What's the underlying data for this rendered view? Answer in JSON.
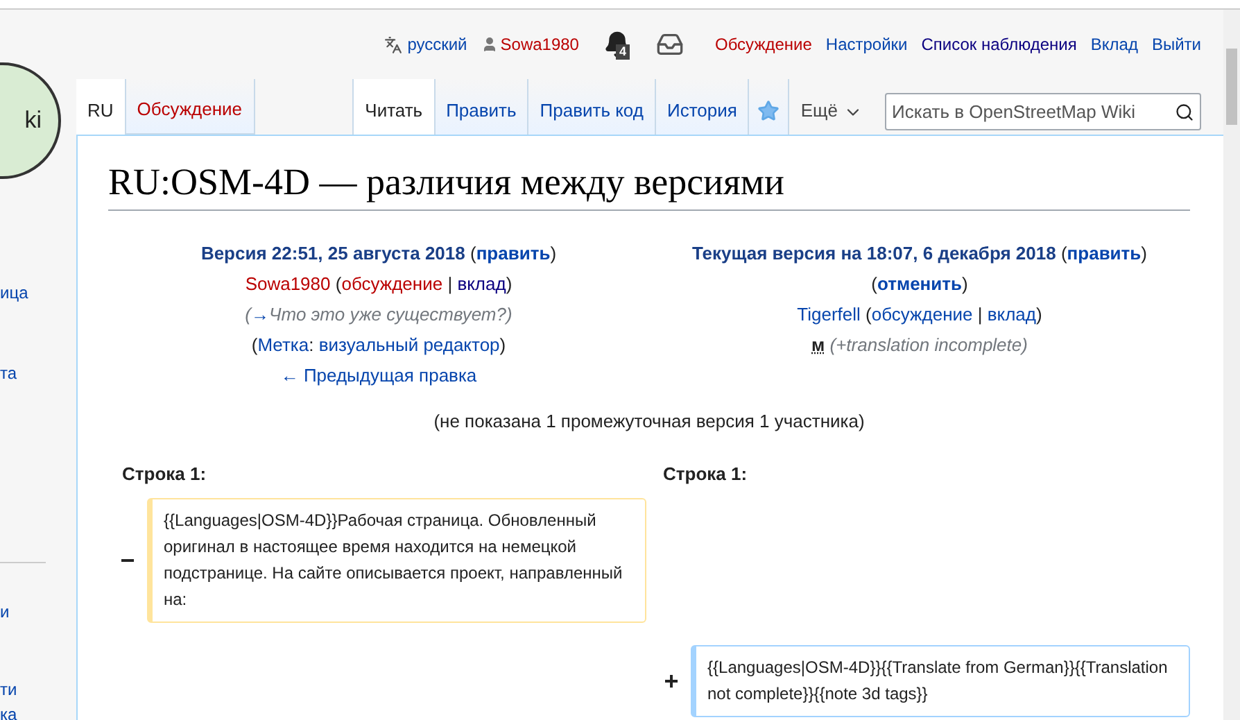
{
  "logo": {
    "text": "ki"
  },
  "sidebar": {
    "items": [
      "ица",
      "та",
      "и",
      "ти",
      "ка"
    ]
  },
  "personal_bar": {
    "language": "русский",
    "user": "Sowa1980",
    "notifications": "4",
    "links": [
      {
        "label": "Обсуждение",
        "color": "#ba0000"
      },
      {
        "label": "Настройки",
        "color": "#0645ad"
      },
      {
        "label": "Список наблюдения",
        "color": "#0b0080"
      },
      {
        "label": "Вклад",
        "color": "#0645ad"
      },
      {
        "label": "Выйти",
        "color": "#0645ad"
      }
    ]
  },
  "namespace_tabs": [
    {
      "label": "RU",
      "selected": true,
      "color": "#222222"
    },
    {
      "label": "Обсуждение",
      "selected": false,
      "color": "#ba0000"
    }
  ],
  "view_tabs": [
    {
      "label": "Читать",
      "selected": true
    },
    {
      "label": "Править",
      "selected": false
    },
    {
      "label": "Править код",
      "selected": false
    },
    {
      "label": "История",
      "selected": false
    }
  ],
  "watched": true,
  "more_menu": "Ещё",
  "search": {
    "placeholder": "Искать в OpenStreetMap Wiki"
  },
  "title": "RU:OSM-4D — различия между версиями",
  "old_revision": {
    "heading": "Версия 22:51, 25 августа 2018",
    "lines": [
      [
        {
          "text": "(",
          "kind": "plain"
        },
        {
          "text": "править",
          "kind": "bold-link"
        },
        {
          "text": ")",
          "kind": "plain"
        }
      ],
      [
        {
          "text": "Sowa1980",
          "kind": "redlink"
        },
        {
          "text": " (",
          "kind": "plain"
        },
        {
          "text": "обсуждение",
          "kind": "redlink"
        },
        {
          "text": " | ",
          "kind": "plain"
        },
        {
          "text": "вклад",
          "kind": "visited"
        },
        {
          "text": ")",
          "kind": "plain"
        }
      ],
      [
        {
          "text": "(",
          "kind": "comment"
        },
        {
          "text": "→",
          "kind": "link"
        },
        {
          "text": "Что это уже существует?)",
          "kind": "comment"
        }
      ],
      [
        {
          "text": "(",
          "kind": "plain"
        },
        {
          "text": "Метка",
          "kind": "link"
        },
        {
          "text": ": ",
          "kind": "plain"
        },
        {
          "text": "визуальный редактор",
          "kind": "link"
        },
        {
          "text": ")",
          "kind": "plain"
        }
      ],
      [
        {
          "text": "← Предыдущая правка",
          "kind": "link"
        }
      ]
    ]
  },
  "new_revision": {
    "heading": "Текущая версия на 18:07, 6 декабря 2018",
    "lines": [
      [
        {
          "text": "(",
          "kind": "plain"
        },
        {
          "text": "править",
          "kind": "bold-link"
        },
        {
          "text": ")",
          "kind": "plain"
        }
      ],
      [
        {
          "text": "(",
          "kind": "plain"
        },
        {
          "text": "отменить",
          "kind": "bold-link"
        },
        {
          "text": ")",
          "kind": "plain"
        }
      ],
      [
        {
          "text": "Tigerfell",
          "kind": "link"
        },
        {
          "text": " (",
          "kind": "plain"
        },
        {
          "text": "обсуждение",
          "kind": "link"
        },
        {
          "text": " | ",
          "kind": "plain"
        },
        {
          "text": "вклад",
          "kind": "link"
        },
        {
          "text": ")",
          "kind": "plain"
        }
      ],
      [
        {
          "text": "м",
          "kind": "minor"
        },
        {
          "text": " (+translation incomplete)",
          "kind": "comment"
        }
      ]
    ]
  },
  "intermediate_note": "(не показана 1 промежуточная версия 1 участника)",
  "diff": {
    "left_line": "Строка 1:",
    "right_line": "Строка 1:",
    "blocks": [
      {
        "kind": "deleted",
        "marker": "−",
        "text": "{{Languages|OSM-4D}}Рабочая страница. Обновленный оригинал в настоящее время находится на немецкой подстранице. На сайте описывается проект, направленный на:"
      },
      {
        "kind": "added",
        "marker": "+",
        "text": "{{Languages|OSM-4D}}{{Translate from German}}{{Translation not complete}}{{note 3d tags}}"
      }
    ]
  }
}
